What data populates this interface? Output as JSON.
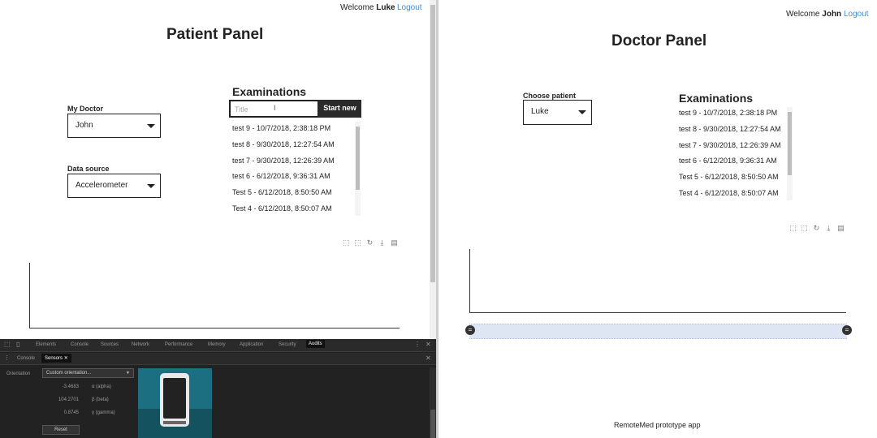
{
  "patient_window": {
    "welcome_prefix": "Welcome",
    "user_name": "Luke",
    "logout_label": "Logout",
    "page_title": "Patient Panel",
    "my_doctor": {
      "label": "My Doctor",
      "value": "John"
    },
    "data_source": {
      "label": "Data source",
      "value": "Accelerometer"
    },
    "examinations": {
      "heading": "Examinations",
      "title_placeholder": "Title",
      "start_button": "Start new",
      "items": [
        "test 9 - 10/7/2018, 2:38:18 PM",
        "test 8 - 9/30/2018, 12:27:54 AM",
        "test 7 - 9/30/2018, 12:26:39 AM",
        "test 6 - 6/12/2018, 9:36:31 AM",
        "Test 5 - 6/12/2018, 8:50:50 AM",
        "Test 4 - 6/12/2018, 8:50:07 AM"
      ]
    },
    "chart_toolbar_icons": [
      "box-zoom-icon",
      "lasso-icon",
      "reset-icon",
      "download-icon",
      "document-icon"
    ]
  },
  "devtools": {
    "tabs": [
      "Elements",
      "Console",
      "Sources",
      "Network",
      "Performance",
      "Memory",
      "Application",
      "Security",
      "Audits"
    ],
    "active_tab": "Audits",
    "drawer_tabs": [
      "Console",
      "Sensors"
    ],
    "active_drawer_tab": "Sensors",
    "orientation_label": "Orientation",
    "orientation_value": "Custom orientation...",
    "alpha_value": "-3.4683",
    "alpha_label": "α (alpha)",
    "beta_value": "104.2701",
    "beta_label": "β (beta)",
    "gamma_value": "0.8745",
    "gamma_label": "γ (gamma)",
    "reset_label": "Reset"
  },
  "doctor_window": {
    "welcome_prefix": "Welcome",
    "user_name": "John",
    "logout_label": "Logout",
    "page_title": "Doctor Panel",
    "choose_patient": {
      "label": "Choose patient",
      "value": "Luke"
    },
    "examinations": {
      "heading": "Examinations",
      "items": [
        "test 9 - 10/7/2018, 2:38:18 PM",
        "test 8 - 9/30/2018, 12:27:54 AM",
        "test 7 - 9/30/2018, 12:26:39 AM",
        "test 6 - 6/12/2018, 9:36:31 AM",
        "Test 5 - 6/12/2018, 8:50:50 AM",
        "Test 4 - 6/12/2018, 8:50:07 AM"
      ]
    },
    "footer": "RemoteMed prototype app"
  },
  "colors": {
    "link": "#3a8fd6",
    "button_dark": "#2b2b2b",
    "range_fill": "#dfe6f3",
    "devtools_bg": "#222222",
    "phone_bg": "#1b6f80"
  }
}
